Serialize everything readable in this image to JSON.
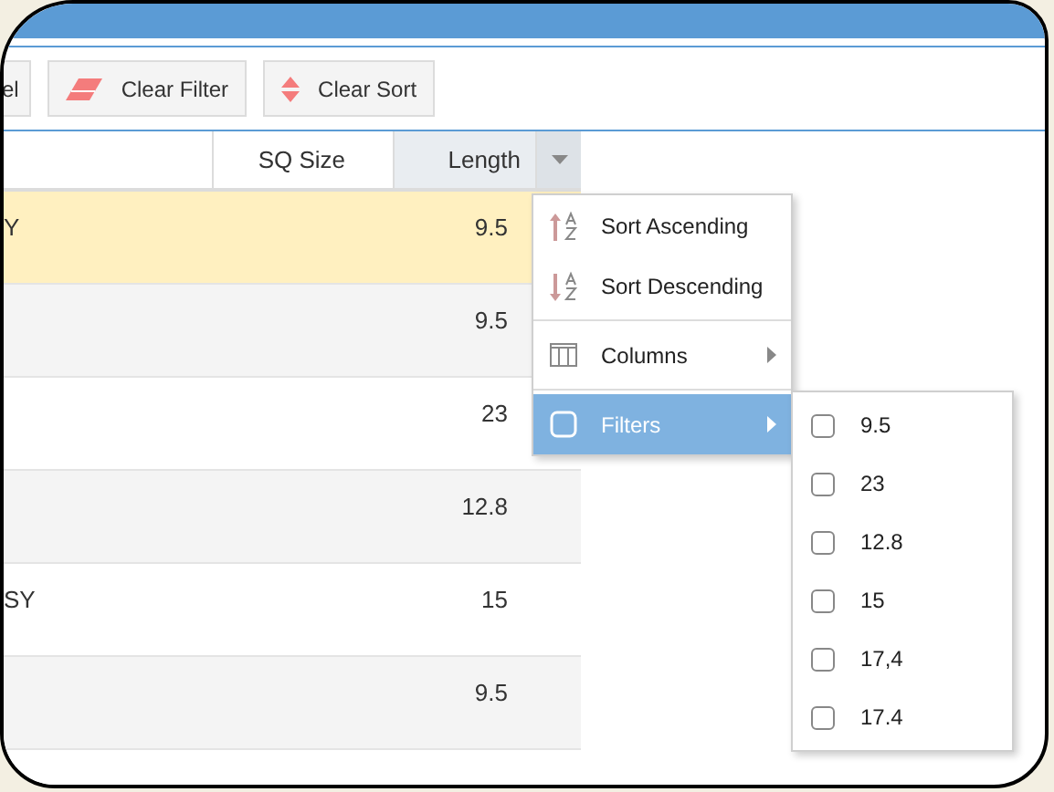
{
  "toolbar": [
    {
      "label": "el"
    },
    {
      "label": "Clear Filter"
    },
    {
      "label": "Clear Sort"
    }
  ],
  "grid": {
    "columns": [
      {
        "label": "SQ Size",
        "active": false
      },
      {
        "label": "Length",
        "active": true
      }
    ],
    "rows": [
      {
        "column_1": "Y",
        "length": "9.5",
        "selected": true
      },
      {
        "length": "9.5",
        "selected": false
      },
      {
        "length": "23",
        "selected": false
      },
      {
        "length": "12.8",
        "selected": false
      },
      {
        "column_1": "SY",
        "length": "15",
        "selected": false
      },
      {
        "length": "9.5",
        "selected": false
      },
      {
        "selected": false
      }
    ]
  },
  "column_menu": {
    "items": [
      {
        "kind": "sort-asc",
        "label": "Sort Ascending",
        "selected": false
      },
      {
        "kind": "sort-desc",
        "label": "Sort Descending",
        "selected": false
      },
      {
        "kind": "columns",
        "label": "Columns",
        "selected": false
      },
      {
        "kind": "filters",
        "label": "Filters",
        "selected": true
      }
    ],
    "filter_options": [
      {
        "label": "9.5",
        "checked": false
      },
      {
        "label": "23",
        "checked": false
      },
      {
        "label": "12.8",
        "checked": false
      },
      {
        "label": "15",
        "checked": false
      },
      {
        "label": "17,4",
        "checked": false
      },
      {
        "label": "17.4",
        "checked": false
      }
    ]
  }
}
